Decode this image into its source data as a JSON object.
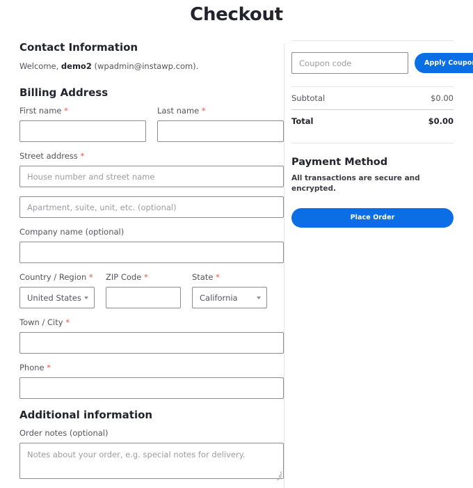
{
  "page": {
    "title": "Checkout"
  },
  "contact": {
    "heading": "Contact Information",
    "welcome_prefix": "Welcome,",
    "welcome_user": "demo2",
    "welcome_email": "(wpadmin@instawp.com)."
  },
  "billing": {
    "heading": "Billing Address",
    "first_name": {
      "label": "First name",
      "required": "*",
      "value": "",
      "placeholder": ""
    },
    "last_name": {
      "label": "Last name",
      "required": "*",
      "value": "",
      "placeholder": ""
    },
    "street_address": {
      "label": "Street address",
      "required": "*",
      "value": "",
      "placeholder": "House number and street name"
    },
    "address_line2": {
      "label": "",
      "value": "",
      "placeholder": "Apartment, suite, unit, etc. (optional)"
    },
    "company": {
      "label": "Company name (optional)",
      "value": "",
      "placeholder": ""
    },
    "country": {
      "label": "Country / Region",
      "required": "*",
      "value": "United States (…",
      "options": [
        "United States (US)"
      ]
    },
    "zip": {
      "label": "ZIP Code",
      "required": "*",
      "value": "",
      "placeholder": ""
    },
    "state": {
      "label": "State",
      "required": "*",
      "value": "California",
      "options": [
        "California"
      ]
    },
    "city": {
      "label": "Town / City",
      "required": "*",
      "value": "",
      "placeholder": ""
    },
    "phone": {
      "label": "Phone",
      "required": "*",
      "value": "",
      "placeholder": ""
    }
  },
  "additional": {
    "heading": "Additional information",
    "order_notes": {
      "label": "Order notes (optional)",
      "value": "",
      "placeholder": "Notes about your order, e.g. special notes for delivery."
    }
  },
  "summary": {
    "coupon": {
      "placeholder": "Coupon code",
      "value": "",
      "apply_label": "Apply Coupon"
    },
    "rows": [
      {
        "label": "Subtotal",
        "amount": "$0.00"
      },
      {
        "label": "Total",
        "amount": "$0.00"
      }
    ],
    "payment": {
      "heading": "Payment Method",
      "note": "All transactions are secure and encrypted.",
      "place_order_label": "Place Order"
    }
  },
  "colors": {
    "accent_blue": "#0c6ee4",
    "required_red": "#e2574c",
    "heading_dark": "#23232d",
    "body_text": "#53535d",
    "border_gray": "#8c8c8c",
    "rule_light": "#e6e6ea"
  }
}
